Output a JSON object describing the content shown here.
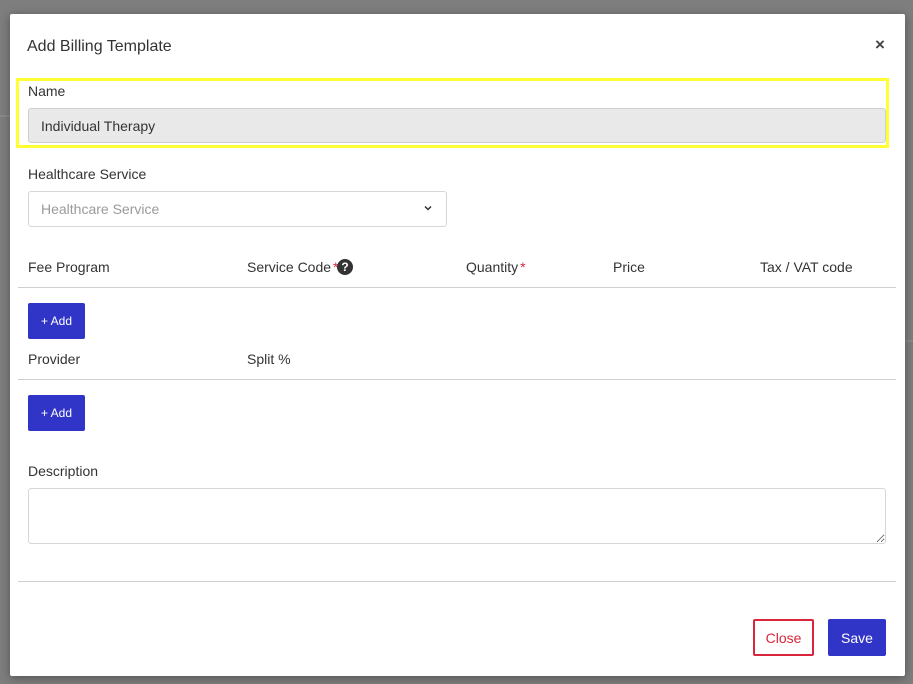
{
  "modal": {
    "title": "Add Billing Template",
    "close_glyph": "×"
  },
  "form": {
    "name_label": "Name",
    "name_value": "Individual Therapy",
    "healthcare_service_label": "Healthcare Service",
    "healthcare_service_placeholder": "Healthcare Service",
    "fee_table": {
      "columns": [
        {
          "label": "Fee Program",
          "required": false
        },
        {
          "label": "Service Code",
          "required": true,
          "help": true
        },
        {
          "label": "Quantity",
          "required": true
        },
        {
          "label": "Price",
          "required": false
        },
        {
          "label": "Tax / VAT code",
          "required": false
        }
      ],
      "add_label": "+ Add"
    },
    "provider_table": {
      "columns": [
        {
          "label": "Provider"
        },
        {
          "label": "Split %"
        }
      ],
      "add_label": "+ Add"
    },
    "description_label": "Description",
    "description_value": ""
  },
  "footer": {
    "close_label": "Close",
    "save_label": "Save"
  },
  "symbols": {
    "required_mark": "*",
    "help_glyph": "?"
  },
  "icons": {
    "modal_close": "close-icon",
    "select_chevron": "chevron-down-icon",
    "service_code_help": "question-circle-icon"
  },
  "colors": {
    "primary": "#3035c8",
    "danger": "#d9263c",
    "highlight": "#ffff33",
    "overlay": "#7e7e7e"
  }
}
